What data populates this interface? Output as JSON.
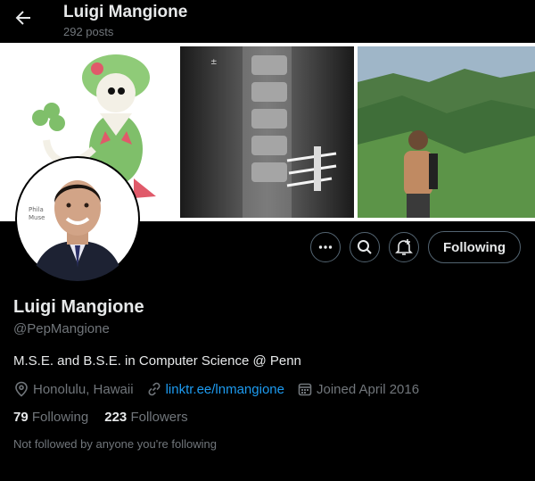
{
  "header": {
    "name": "Luigi Mangione",
    "posts": "292 posts"
  },
  "banner": {
    "panels": [
      "pokemon-illustration",
      "spine-xray",
      "mountain-hiker-photo"
    ]
  },
  "actions": {
    "more_icon": "more-horizontal-icon",
    "search_icon": "search-icon",
    "notify_icon": "bell-plus-icon",
    "follow_label": "Following"
  },
  "profile": {
    "name": "Luigi Mangione",
    "handle": "@PepMangione",
    "bio": "M.S.E. and B.S.E. in Computer Science @ Penn",
    "location": "Honolulu, Hawaii",
    "link": "linktr.ee/lnmangione",
    "joined": "Joined April 2016",
    "following_count": "79",
    "following_label": "Following",
    "followers_count": "223",
    "followers_label": "Followers",
    "followed_by_note": "Not followed by anyone you're following"
  },
  "colors": {
    "background": "#000000",
    "text": "#e7e9ea",
    "muted": "#71767b",
    "link": "#1d9bf0",
    "border": "#536471"
  }
}
